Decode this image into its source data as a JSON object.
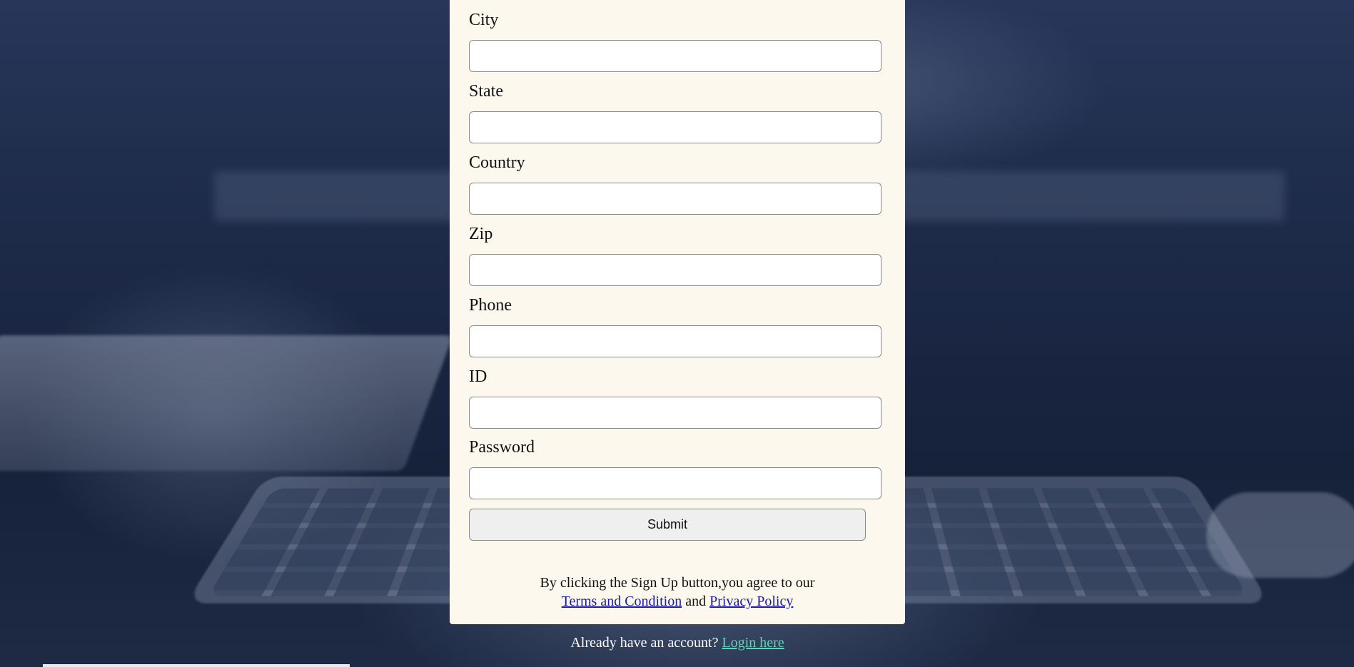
{
  "form": {
    "fields": [
      {
        "label": "City",
        "value": ""
      },
      {
        "label": "State",
        "value": ""
      },
      {
        "label": "Country",
        "value": ""
      },
      {
        "label": "Zip",
        "value": ""
      },
      {
        "label": "Phone",
        "value": ""
      },
      {
        "label": "ID",
        "value": ""
      },
      {
        "label": "Password",
        "value": ""
      }
    ],
    "submit_label": "Submit"
  },
  "terms": {
    "text_before": "By clicking the Sign Up button,you agree to our",
    "terms_link": "Terms and Condition",
    "and_text": "and",
    "privacy_link": "Privacy Policy"
  },
  "login": {
    "prompt": "Already have an account?",
    "link_label": "Login here"
  },
  "colors": {
    "panel_background": "#fcf8ee",
    "link": "#1a1aa6",
    "login_link": "#5ed3b6",
    "background": "#1c2842"
  }
}
